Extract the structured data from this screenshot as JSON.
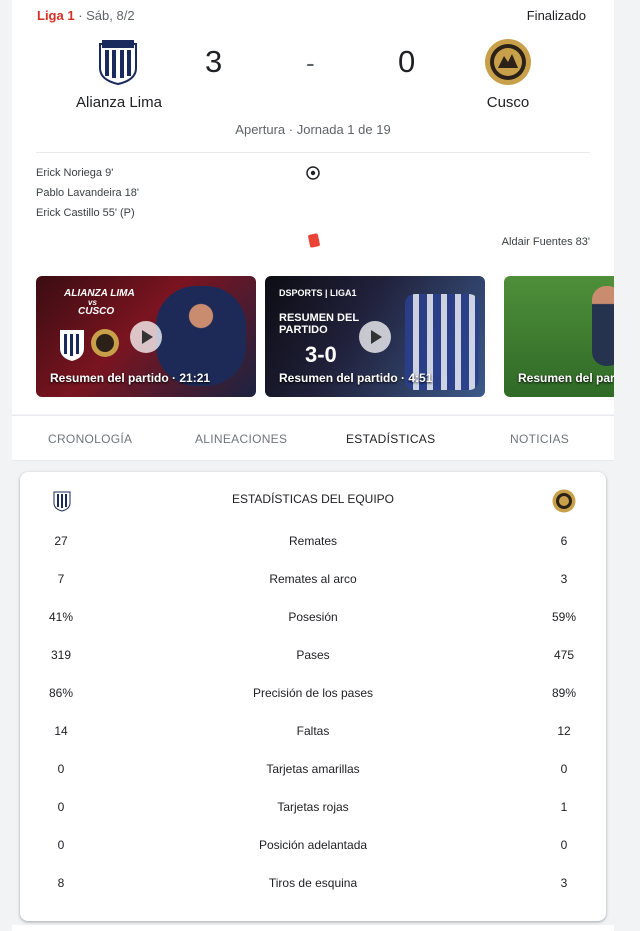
{
  "header": {
    "league": "Liga 1",
    "date": " · Sáb, 8/2",
    "status": "Finalizado"
  },
  "match": {
    "home_team": "Alianza Lima",
    "away_team": "Cusco",
    "home_score": "3",
    "away_score": "0",
    "separator": "-",
    "round": "Apertura · Jornada 1 de 19"
  },
  "events": {
    "home": [
      "Erick Noriega 9'",
      "Pablo Lavandeira 18'",
      "Erick Castillo 55' (P)"
    ],
    "away": [
      "Aldair Fuentes 83'"
    ]
  },
  "videos": [
    {
      "caption": "Resumen del partido · 21:21",
      "overlay_top": "ALIANZA LIMA",
      "overlay_vs": "vs",
      "overlay_bottom": "CUSCO"
    },
    {
      "caption": "Resumen del partido · 4:51",
      "overlay_brand": "DSPORTS | LIGA1",
      "overlay_title": "RESUMEN DEL PARTIDO",
      "overlay_score": "3-0"
    },
    {
      "caption": "Resumen del parti"
    }
  ],
  "tabs": [
    "CRONOLOGÍA",
    "ALINEACIONES",
    "ESTADÍSTICAS",
    "NOTICIAS"
  ],
  "active_tab": "ESTADÍSTICAS",
  "stats": {
    "title": "ESTADÍSTICAS DEL EQUIPO",
    "rows": [
      {
        "label": "Remates",
        "home": "27",
        "away": "6"
      },
      {
        "label": "Remates al arco",
        "home": "7",
        "away": "3"
      },
      {
        "label": "Posesión",
        "home": "41%",
        "away": "59%"
      },
      {
        "label": "Pases",
        "home": "319",
        "away": "475"
      },
      {
        "label": "Precisión de los pases",
        "home": "86%",
        "away": "89%"
      },
      {
        "label": "Faltas",
        "home": "14",
        "away": "12"
      },
      {
        "label": "Tarjetas amarillas",
        "home": "0",
        "away": "0"
      },
      {
        "label": "Tarjetas rojas",
        "home": "0",
        "away": "1"
      },
      {
        "label": "Posición adelantada",
        "home": "0",
        "away": "0"
      },
      {
        "label": "Tiros de esquina",
        "home": "8",
        "away": "3"
      }
    ]
  },
  "colors": {
    "league_red": "#d93025",
    "red_card": "#ea4335",
    "alianza_navy": "#1a2a5c",
    "cusco_gold": "#c8a04a"
  }
}
